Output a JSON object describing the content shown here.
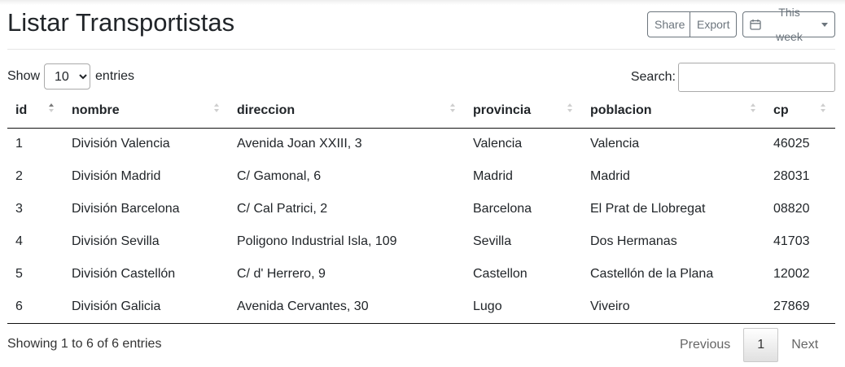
{
  "page": {
    "title": "Listar Transportistas"
  },
  "toolbar": {
    "share_label": "Share",
    "export_label": "Export",
    "period_label": "This week"
  },
  "length": {
    "show_label": "Show",
    "value": "10",
    "entries_label": "entries"
  },
  "search": {
    "label": "Search:",
    "value": "",
    "placeholder": ""
  },
  "table": {
    "columns": [
      "id",
      "nombre",
      "direccion",
      "provincia",
      "poblacion",
      "cp"
    ],
    "rows": [
      [
        "1",
        "División Valencia",
        "Avenida Joan XXIII, 3",
        "Valencia",
        "Valencia",
        "46025"
      ],
      [
        "2",
        "División Madrid",
        "C/ Gamonal, 6",
        "Madrid",
        "Madrid",
        "28031"
      ],
      [
        "3",
        "División Barcelona",
        "C/ Cal Patrici, 2",
        "Barcelona",
        "El Prat de Llobregat",
        "08820"
      ],
      [
        "4",
        "División Sevilla",
        "Poligono Industrial Isla, 109",
        "Sevilla",
        "Dos Hermanas",
        "41703"
      ],
      [
        "5",
        "División Castellón",
        "C/ d' Herrero, 9",
        "Castellon",
        "Castellón de la Plana",
        "12002"
      ],
      [
        "6",
        "División Galicia",
        "Avenida Cervantes, 30",
        "Lugo",
        "Viveiro",
        "27869"
      ]
    ]
  },
  "footer": {
    "info": "Showing 1 to 6 of 6 entries",
    "previous_label": "Previous",
    "current_page": "1",
    "next_label": "Next"
  },
  "icons": {
    "period": "calendar-icon"
  },
  "colors": {
    "text": "#212529",
    "muted": "#6c757d"
  }
}
